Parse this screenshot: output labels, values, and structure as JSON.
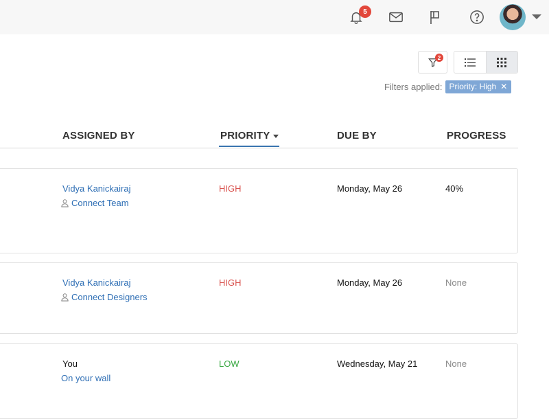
{
  "topbar": {
    "notifications_count": "5",
    "icons": [
      "bell-icon",
      "mail-icon",
      "flag-icon",
      "help-icon"
    ]
  },
  "toolbar": {
    "filter_count": "2",
    "filters_label": "Filters applied:",
    "filter_chip": "Priority: High",
    "filter_chip_close": "✕"
  },
  "columns": {
    "assigned_by": "ASSIGNED BY",
    "priority": "PRIORITY",
    "due_by": "DUE BY",
    "progress": "PROGRESS"
  },
  "tasks": [
    {
      "assigned_by": "Vidya Kanickairaj",
      "group": "Connect Team",
      "priority": "HIGH",
      "due": "Monday, May 26",
      "progress": "40%"
    },
    {
      "assigned_by": "Vidya Kanickairaj",
      "group": "Connect Designers",
      "priority": "HIGH",
      "due": "Monday, May 26",
      "progress": "None"
    },
    {
      "assigned_by": "You",
      "group": "On your wall",
      "priority": "LOW",
      "due": "Wednesday, May 21",
      "progress": "None"
    }
  ],
  "colors": {
    "high": "#d9534f",
    "low": "#3aa843",
    "link": "#2f6fb5",
    "badge": "#e2473b",
    "chip": "#7fa7d6"
  }
}
